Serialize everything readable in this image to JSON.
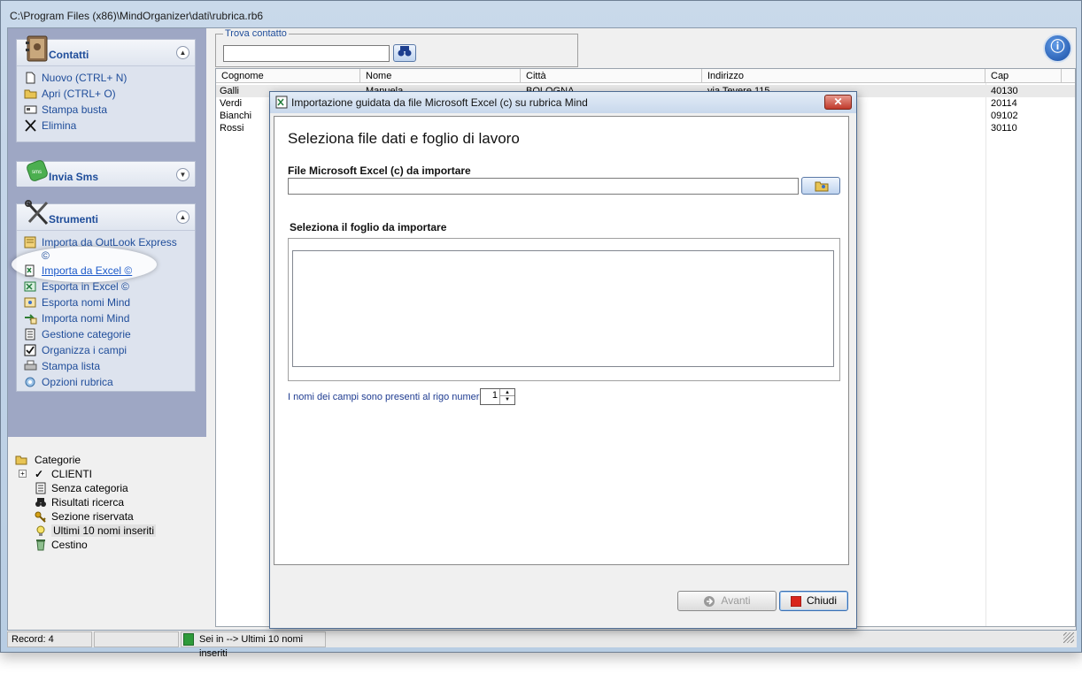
{
  "window": {
    "title": "C:\\Program Files (x86)\\MindOrganizer\\dati\\rubrica.rb6"
  },
  "sidebar": {
    "contatti": {
      "title": "Contatti",
      "items": [
        "Nuovo (CTRL+ N)",
        "Apri (CTRL+ O)",
        "Stampa busta",
        "Elimina"
      ]
    },
    "sms": {
      "title": "Invia Sms"
    },
    "strumenti": {
      "title": "Strumenti",
      "items": [
        "Importa da OutLook Express",
        "©",
        "Importa da Excel ©",
        "Esporta in Excel ©",
        "Esporta nomi Mind",
        "Importa nomi Mind",
        "Gestione categorie",
        "Organizza i campi",
        "Stampa lista",
        "Opzioni rubrica"
      ]
    }
  },
  "tree": {
    "root": "Categorie",
    "items": [
      "CLIENTI",
      "Senza categoria",
      "Risultati ricerca",
      "Sezione riservata",
      "Ultimi 10 nomi inseriti",
      "Cestino"
    ]
  },
  "search": {
    "legend": "Trova contatto",
    "value": ""
  },
  "grid": {
    "columns": [
      "Cognome",
      "Nome",
      "Città",
      "Indirizzo",
      "Cap"
    ],
    "rows": [
      [
        "Galli",
        "Manuela",
        "BOLOGNA",
        "via Tevere 115",
        "40130"
      ],
      [
        "Verdi",
        "",
        "",
        "",
        "20114"
      ],
      [
        "Bianchi",
        "",
        "",
        "",
        "09102"
      ],
      [
        "Rossi",
        "",
        "",
        "",
        "30110"
      ]
    ]
  },
  "status": {
    "record": "Record: 4",
    "location": "Sei in --> Ultimi 10 nomi inseriti"
  },
  "dialog": {
    "title": "Importazione guidata da file Microsoft Excel (c) su rubrica Mind",
    "close": "✕",
    "heading": "Seleziona file dati e foglio di lavoro",
    "file_label": "File Microsoft Excel (c) da importare",
    "file_value": "",
    "sheet_label": "Seleziona il foglio da importare",
    "row_label": "I nomi dei campi sono presenti al rigo numero:",
    "row_value": "1",
    "next": "Avanti",
    "close_btn": "Chiudi"
  },
  "colors": {
    "accent": "#1f4d9a",
    "panel": "#9ea7c4",
    "link": "#1a58c9"
  }
}
